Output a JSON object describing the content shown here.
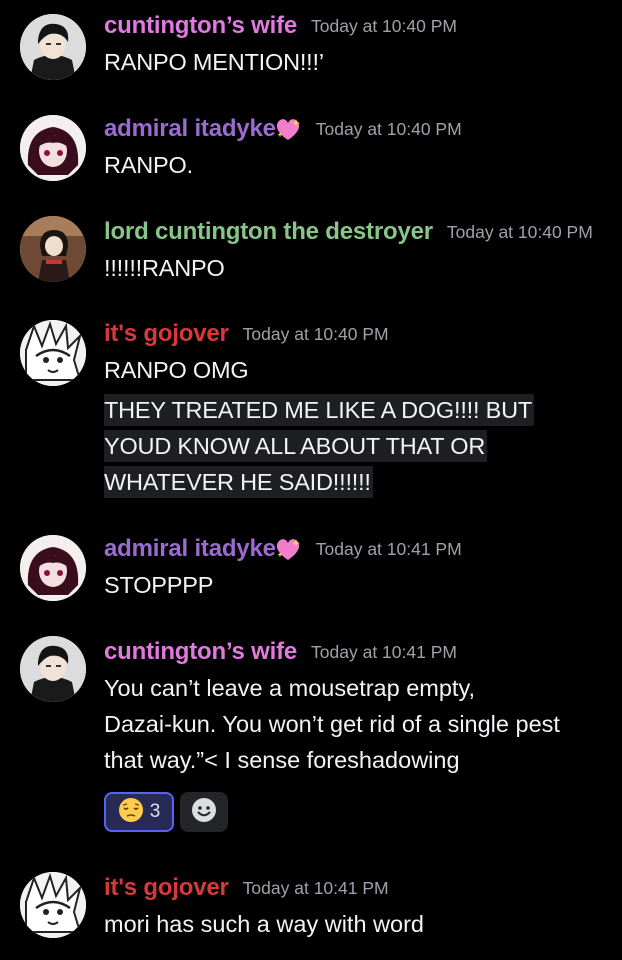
{
  "colors": {
    "background": "#000000",
    "wife_name": "#e07ae0",
    "admiral_name": "#9b6bd0",
    "lord_name": "#88c588",
    "gojover_name": "#d8383a",
    "timestamp": "#9ea2a9",
    "reaction_active_bg": "#262a55",
    "reaction_active_border": "#5865f2"
  },
  "messages": [
    {
      "username": "cuntington’s wife",
      "timestamp": "Today at 10:40 PM",
      "lines": [
        "RANPO MENTION!!!’"
      ]
    },
    {
      "username": "admiral itadyke",
      "badge": "sparkling-heart-icon",
      "timestamp": "Today at 10:40 PM",
      "lines": [
        "RANPO."
      ]
    },
    {
      "username": "lord cuntington the destroyer",
      "timestamp": "Today at 10:40 PM",
      "lines": [
        "!!!!!!RANPO"
      ]
    },
    {
      "username": "it's gojover",
      "timestamp": "Today at 10:40 PM",
      "lines": [
        "RANPO OMG"
      ],
      "highlighted_lines": [
        "THEY TREATED ME LIKE A DOG!!!! BUT",
        "YOUD KNOW ALL ABOUT THAT OR",
        "WHATEVER HE SAID!!!!!!"
      ]
    },
    {
      "username": "admiral itadyke",
      "badge": "sparkling-heart-icon",
      "timestamp": "Today at 10:41 PM",
      "lines": [
        "STOPPPP"
      ]
    },
    {
      "username": "cuntington’s wife",
      "timestamp": "Today at 10:41 PM",
      "lines": [
        "You can’t leave a mousetrap empty,",
        "Dazai-kun. You won’t get rid of a single pest",
        "that way.”< I sense foreshadowing"
      ],
      "reactions": [
        {
          "emoji": "pensive-face-icon",
          "count": "3"
        },
        {
          "emoji": "add-reaction-icon"
        }
      ]
    },
    {
      "username": "it's gojover",
      "timestamp": "Today at 10:41 PM",
      "lines": [
        "mori has such a way with word"
      ]
    }
  ]
}
